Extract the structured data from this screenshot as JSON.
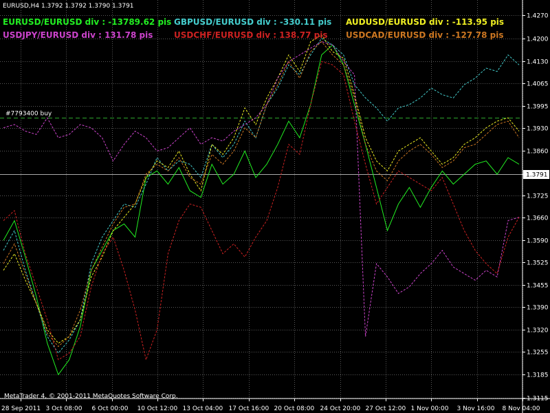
{
  "chart_title": "EURUSD,H4  1.3792 1.3792 1.3790 1.3791",
  "copyright": "MetaTrader 4, © 2001-2011 MetaQuotes Software Corp.",
  "current_price": "1.3791",
  "order_label": "#7793400 buy",
  "order_price": 1.396,
  "legend": [
    {
      "label": "EURUSD/EURUSD div : -13789.62 pis",
      "color": "#22ee22",
      "row": 0,
      "col": 0
    },
    {
      "label": "GBPUSD/EURUSD div : -330.11 pis",
      "color": "#44cccc",
      "row": 0,
      "col": 1
    },
    {
      "label": "AUDUSD/EURUSD div : -113.95 pis",
      "color": "#eeee22",
      "row": 0,
      "col": 2
    },
    {
      "label": "USDJPY/EURUSD div : 131.78 pis",
      "color": "#cc44cc",
      "row": 1,
      "col": 0
    },
    {
      "label": "USDCHF/EURUSD div : 138.77 pis",
      "color": "#cc2222",
      "row": 1,
      "col": 1
    },
    {
      "label": "USDCAD/EURUSD div : -127.78 pis",
      "color": "#cc7722",
      "row": 1,
      "col": 2
    }
  ],
  "colors": {
    "background": "#000000",
    "grid": "#5a5a5a",
    "text": "#ffffff",
    "order_line": "#2fa82f",
    "current_line": "#aaaaaa"
  },
  "chart_data": {
    "type": "line",
    "title": "EURUSD,H4  1.3792 1.3792 1.3790 1.3791",
    "xlabel": "",
    "ylabel": "",
    "ylim": [
      1.3115,
      1.427
    ],
    "y_ticks": [
      "1.4270",
      "1.4200",
      "1.4130",
      "1.4065",
      "1.3995",
      "1.3930",
      "1.3860",
      "1.3791",
      "1.3725",
      "1.3660",
      "1.3590",
      "1.3525",
      "1.3455",
      "1.3390",
      "1.3320",
      "1.3255",
      "1.3185",
      "1.3115"
    ],
    "x_ticks": [
      "28 Sep 2011",
      "3 Oct 08:00",
      "6 Oct 00:00",
      "10 Oct 12:00",
      "13 Oct 04:00",
      "17 Oct 16:00",
      "20 Oct 08:00",
      "24 Oct 20:00",
      "27 Oct 12:00",
      "1 Nov 00:00",
      "3 Nov 16:00",
      "8 Nov 04:00"
    ],
    "grid": true,
    "legend_position": "top-left",
    "series": [
      {
        "name": "EURUSD/EURUSD",
        "color": "#22ee22",
        "style": "solid",
        "values": [
          1.359,
          1.365,
          1.354,
          1.342,
          1.328,
          1.3185,
          1.323,
          1.333,
          1.35,
          1.356,
          1.362,
          1.364,
          1.36,
          1.378,
          1.38,
          1.376,
          1.381,
          1.374,
          1.372,
          1.382,
          1.376,
          1.379,
          1.386,
          1.378,
          1.382,
          1.388,
          1.395,
          1.39,
          1.4,
          1.415,
          1.418,
          1.412,
          1.4,
          1.388,
          1.375,
          1.362,
          1.37,
          1.375,
          1.369,
          1.375,
          1.38,
          1.376,
          1.379,
          1.382,
          1.383,
          1.379,
          1.384,
          1.382
        ]
      },
      {
        "name": "GBPUSD/EURUSD",
        "color": "#44cccc",
        "style": "dashed",
        "values": [
          1.356,
          1.362,
          1.35,
          1.34,
          1.33,
          1.325,
          1.329,
          1.335,
          1.352,
          1.36,
          1.365,
          1.37,
          1.369,
          1.376,
          1.384,
          1.38,
          1.383,
          1.382,
          1.378,
          1.388,
          1.384,
          1.388,
          1.395,
          1.39,
          1.4,
          1.405,
          1.412,
          1.409,
          1.415,
          1.42,
          1.418,
          1.415,
          1.406,
          1.402,
          1.399,
          1.395,
          1.399,
          1.4,
          1.402,
          1.405,
          1.403,
          1.402,
          1.406,
          1.408,
          1.411,
          1.41,
          1.415,
          1.412
        ]
      },
      {
        "name": "AUDUSD/EURUSD",
        "color": "#eeee22",
        "style": "dashed",
        "values": [
          1.35,
          1.355,
          1.347,
          1.34,
          1.332,
          1.328,
          1.33,
          1.335,
          1.348,
          1.354,
          1.362,
          1.366,
          1.37,
          1.378,
          1.383,
          1.381,
          1.386,
          1.379,
          1.374,
          1.388,
          1.385,
          1.39,
          1.399,
          1.394,
          1.402,
          1.408,
          1.415,
          1.41,
          1.419,
          1.421,
          1.416,
          1.414,
          1.403,
          1.39,
          1.383,
          1.38,
          1.386,
          1.388,
          1.39,
          1.386,
          1.382,
          1.384,
          1.388,
          1.39,
          1.393,
          1.395,
          1.396,
          1.392
        ]
      },
      {
        "name": "USDJPY/EURUSD",
        "color": "#cc44cc",
        "style": "dashed",
        "values": [
          1.393,
          1.394,
          1.392,
          1.391,
          1.396,
          1.39,
          1.391,
          1.394,
          1.393,
          1.39,
          1.383,
          1.388,
          1.392,
          1.39,
          1.386,
          1.387,
          1.39,
          1.393,
          1.388,
          1.39,
          1.389,
          1.392,
          1.394,
          1.396,
          1.4,
          1.408,
          1.413,
          1.415,
          1.417,
          1.419,
          1.418,
          1.413,
          1.409,
          1.33,
          1.352,
          1.348,
          1.343,
          1.345,
          1.349,
          1.352,
          1.356,
          1.351,
          1.349,
          1.347,
          1.35,
          1.348,
          1.365,
          1.366
        ]
      },
      {
        "name": "USDCHF/EURUSD",
        "color": "#cc2222",
        "style": "dashed",
        "values": [
          1.365,
          1.368,
          1.355,
          1.345,
          1.335,
          1.323,
          1.325,
          1.33,
          1.345,
          1.355,
          1.36,
          1.35,
          1.338,
          1.323,
          1.332,
          1.355,
          1.365,
          1.37,
          1.369,
          1.362,
          1.355,
          1.358,
          1.354,
          1.36,
          1.365,
          1.375,
          1.388,
          1.385,
          1.4,
          1.413,
          1.412,
          1.409,
          1.395,
          1.382,
          1.37,
          1.375,
          1.38,
          1.378,
          1.376,
          1.374,
          1.378,
          1.37,
          1.362,
          1.356,
          1.352,
          1.349,
          1.36,
          1.366
        ]
      },
      {
        "name": "USDCAD/EURUSD",
        "color": "#cc7722",
        "style": "dashed",
        "values": [
          1.352,
          1.358,
          1.349,
          1.34,
          1.331,
          1.327,
          1.33,
          1.338,
          1.35,
          1.357,
          1.364,
          1.369,
          1.37,
          1.379,
          1.382,
          1.38,
          1.384,
          1.378,
          1.376,
          1.385,
          1.382,
          1.386,
          1.393,
          1.39,
          1.4,
          1.406,
          1.413,
          1.408,
          1.416,
          1.419,
          1.415,
          1.412,
          1.402,
          1.388,
          1.38,
          1.377,
          1.383,
          1.386,
          1.388,
          1.385,
          1.381,
          1.383,
          1.387,
          1.388,
          1.391,
          1.394,
          1.395,
          1.39
        ]
      }
    ]
  }
}
